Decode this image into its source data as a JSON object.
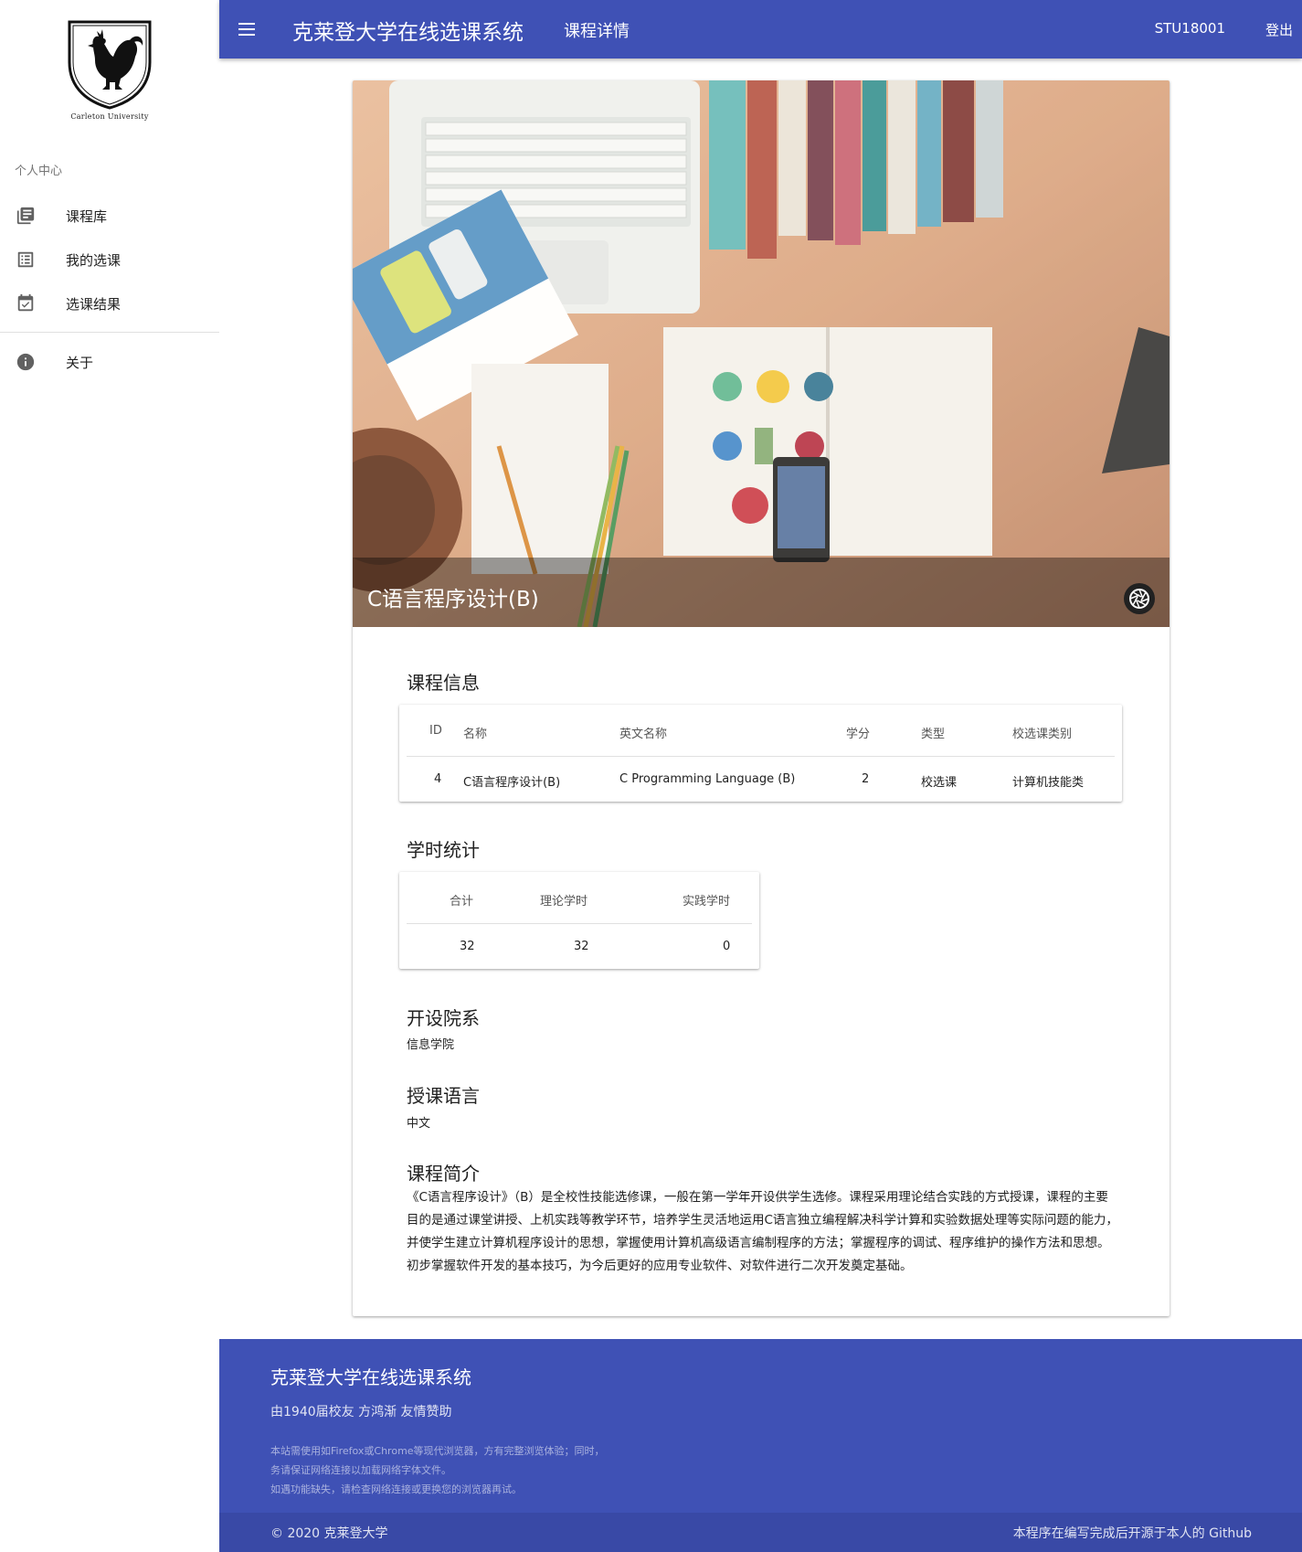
{
  "sidebar": {
    "logo_caption": "Carleton University",
    "subheader": "个人中心",
    "items": [
      {
        "label": "课程库",
        "icon": "library-books-icon"
      },
      {
        "label": "我的选课",
        "icon": "list-alt-icon"
      },
      {
        "label": "选课结果",
        "icon": "event-available-icon"
      },
      {
        "label": "关于",
        "icon": "info-icon"
      }
    ]
  },
  "appbar": {
    "title": "克莱登大学在线选课系统",
    "subtitle": "课程详情",
    "user_id": "STU18001",
    "logout": "登出"
  },
  "course": {
    "hero_title": "C语言程序设计(B)",
    "info_title": "课程信息",
    "info_headers": [
      "ID",
      "名称",
      "英文名称",
      "学分",
      "类型",
      "校选课类别"
    ],
    "info_row": [
      "4",
      "C语言程序设计(B)",
      "C Programming Language (B)",
      "2",
      "校选课",
      "计算机技能类"
    ],
    "hours_title": "学时统计",
    "hours_headers": [
      "合计",
      "理论学时",
      "实践学时"
    ],
    "hours_row": [
      "32",
      "32",
      "0"
    ],
    "dept_title": "开设院系",
    "dept_value": "信息学院",
    "lang_title": "授课语言",
    "lang_value": "中文",
    "intro_title": "课程简介",
    "intro_text": "《C语言程序设计》（B）是全校性技能选修课，一般在第一学年开设供学生选修。课程采用理论结合实践的方式授课，课程的主要目的是通过课堂讲授、上机实践等教学环节，培养学生灵活地运用C语言独立编程解决科学计算和实验数据处理等实际问题的能力，并使学生建立计算机程序设计的思想，掌握使用计算机高级语言编制程序的方法；掌握程序的调试、程序维护的操作方法和思想。初步掌握软件开发的基本技巧，为今后更好的应用专业软件、对软件进行二次开发奠定基础。"
  },
  "footer": {
    "title": "克莱登大学在线选课系统",
    "subtitle": "由1940届校友 方鸿渐 友情赞助",
    "notes": [
      "本站需使用如Firefox或Chrome等现代浏览器，方有完整浏览体验；同时，",
      "务请保证网络连接以加载网络字体文件。",
      "如遇功能缺失，请检查网络连接或更换您的浏览器再试。"
    ],
    "copyright": "© 2020 克莱登大学",
    "source_link": "本程序在编写完成后开源于本人的 Github"
  },
  "colors": {
    "primary": "#3f51b5",
    "footer_bottom": "#3949a6"
  }
}
